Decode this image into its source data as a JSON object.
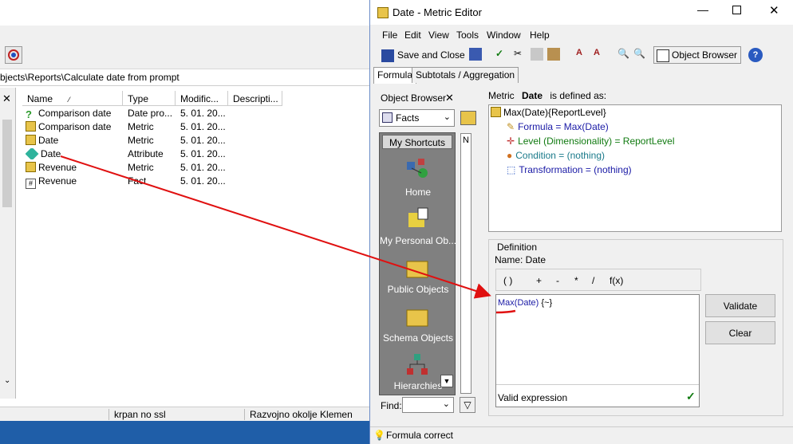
{
  "background_window": {
    "path": "bjects\\Reports\\Calculate date from prompt",
    "columns": [
      "Name",
      "Type",
      "Modific...",
      "Descripti..."
    ],
    "rows": [
      {
        "name": "Comparison date",
        "type": "Date pro...",
        "modified": "5. 01. 20...",
        "icon": "prompt-icon"
      },
      {
        "name": "Comparison date",
        "type": "Metric",
        "modified": "5. 01. 20...",
        "icon": "metric-icon"
      },
      {
        "name": "Date",
        "type": "Metric",
        "modified": "5. 01. 20...",
        "icon": "metric-icon"
      },
      {
        "name": "Date",
        "type": "Attribute",
        "modified": "5. 01. 20...",
        "icon": "attribute-icon"
      },
      {
        "name": "Revenue",
        "type": "Metric",
        "modified": "5. 01. 20...",
        "icon": "metric-icon"
      },
      {
        "name": "Revenue",
        "type": "Fact",
        "modified": "5. 01. 20...",
        "icon": "fact-icon"
      }
    ],
    "status": {
      "server": "krpan no ssl",
      "environment": "Razvojno okolje Klemen"
    }
  },
  "editor": {
    "title": "Date - Metric Editor",
    "menu": [
      "File",
      "Edit",
      "View",
      "Tools",
      "Window",
      "Help"
    ],
    "toolbar": {
      "save_close": "Save and Close",
      "object_browser": "Object Browser"
    },
    "tabs": [
      "Formula",
      "Subtotals / Aggregation"
    ],
    "object_browser": {
      "header": "Object Browser",
      "combo_value": "Facts",
      "shortcuts_header": "My Shortcuts",
      "shortcuts": [
        "Home",
        "My Personal Ob...",
        "Public Objects",
        "Schema Objects",
        "Hierarchies"
      ],
      "list_header": "N",
      "find_label": "Find:"
    },
    "definition": {
      "metric_label": "Metric",
      "metric_name": "Date",
      "defined_as": "is defined as:",
      "tree_root": "Max(Date){ReportLevel}",
      "tree_children": [
        "Formula = Max(Date)",
        "Level (Dimensionality) = ReportLevel",
        "Condition = (nothing)",
        "Transformation = (nothing)"
      ],
      "group_label": "Definition",
      "name_line": "Name:  Date",
      "operators": [
        "( )",
        "+",
        "-",
        "*",
        "/",
        "f(x)"
      ],
      "formula_func": "Max(Date)",
      "formula_rest": " {~}",
      "validation": "Valid expression",
      "validate_btn": "Validate",
      "clear_btn": "Clear"
    },
    "status": "Formula correct"
  },
  "colors": {
    "annotation": "#e01010",
    "link_blue": "#1a1aa6",
    "green_text": "#107a10",
    "teal_text": "#1a7a8a"
  }
}
